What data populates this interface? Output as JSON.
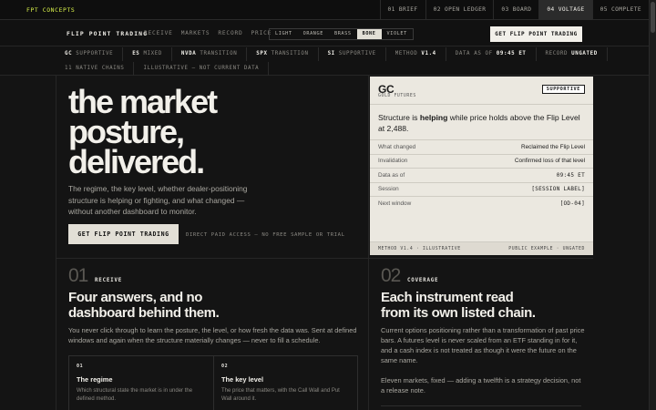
{
  "topbar": {
    "brand": "FPT CONCEPTS",
    "steps": [
      {
        "label": "01 BRIEF"
      },
      {
        "label": "02 OPEN LEDGER"
      },
      {
        "label": "03 BOARD"
      },
      {
        "label": "04 VOLTAGE",
        "active": true
      },
      {
        "label": "05 COMPLETE"
      }
    ]
  },
  "nav": {
    "brand": "FLIP POINT TRADING",
    "links": [
      "RECEIVE",
      "MARKETS",
      "RECORD",
      "PRICE"
    ],
    "themes": [
      "LIGHT",
      "ORANGE",
      "BRASS",
      "BONE",
      "VIOLET"
    ],
    "active_theme": "BONE",
    "cta": "GET FLIP POINT TRADING"
  },
  "ticker": {
    "row1": [
      {
        "sym": "GC",
        "state": "SUPPORTIVE"
      },
      {
        "sym": "ES",
        "state": "MIXED"
      },
      {
        "sym": "NVDA",
        "state": "TRANSITION"
      },
      {
        "sym": "SPX",
        "state": "TRANSITION"
      },
      {
        "sym": "SI",
        "state": "SUPPORTIVE"
      },
      {
        "sym": "METHOD",
        "state": "V1.4"
      },
      {
        "sym": "DATA AS OF",
        "state": "09:45 ET"
      },
      {
        "sym": "RECORD",
        "state": "UNGATED"
      }
    ],
    "row2": [
      "11 NATIVE CHAINS",
      "ILLUSTRATIVE — NOT CURRENT DATA"
    ]
  },
  "hero": {
    "title_lines": [
      "the market",
      "posture,",
      "delivered."
    ],
    "description": "The regime, the key level, whether dealer-positioning structure is helping or fighting, and what changed — without another dashboard to monitor.",
    "cta": "GET FLIP POINT TRADING",
    "note": "DIRECT PAID ACCESS — NO FREE SAMPLE OR TRIAL"
  },
  "card": {
    "symbol": "GC",
    "name": "GOLD FUTURES",
    "badge": "SUPPORTIVE",
    "statement_pre": "Structure is ",
    "statement_bold": "helping",
    "statement_post": " while price holds above the Flip Level at 2,488.",
    "rows": [
      {
        "k": "What changed",
        "v": "Reclaimed the Flip Level",
        "mono": false
      },
      {
        "k": "Invalidation",
        "v": "Confirmed loss of that level",
        "mono": false
      },
      {
        "k": "Data as of",
        "v": "09:45 ET",
        "mono": true
      },
      {
        "k": "Session",
        "v": "[SESSION LABEL]",
        "mono": true
      },
      {
        "k": "Next window",
        "v": "[OD-04]",
        "mono": true
      }
    ],
    "foot_left": "METHOD V1.4 · ILLUSTRATIVE",
    "foot_right": "PUBLIC EXAMPLE · UNGATED"
  },
  "section1": {
    "num": "01",
    "label": "RECEIVE",
    "title_lines": [
      "Four answers, and no",
      "dashboard behind them."
    ],
    "body": "You never click through to learn the posture, the level, or how fresh the data was. Sent at defined windows and again when the structure materially changes — never to fill a schedule.",
    "cards": [
      {
        "num": "01",
        "title": "The regime",
        "text": "Which structural state the market is in under the defined method."
      },
      {
        "num": "02",
        "title": "The key level",
        "text": "The price that matters, with the Call Wall and Put Wall around it."
      }
    ]
  },
  "section2": {
    "num": "02",
    "label": "COVERAGE",
    "title_lines": [
      "Each instrument read",
      "from its own listed chain."
    ],
    "body1": "Current options positioning rather than a transformation of past price bars. A futures level is never scaled from an ETF standing in for it, and a cash index is not treated as though it were the future on the same name.",
    "body2": "Eleven markets, fixed — adding a twelfth is a strategy decision, not a release note."
  }
}
